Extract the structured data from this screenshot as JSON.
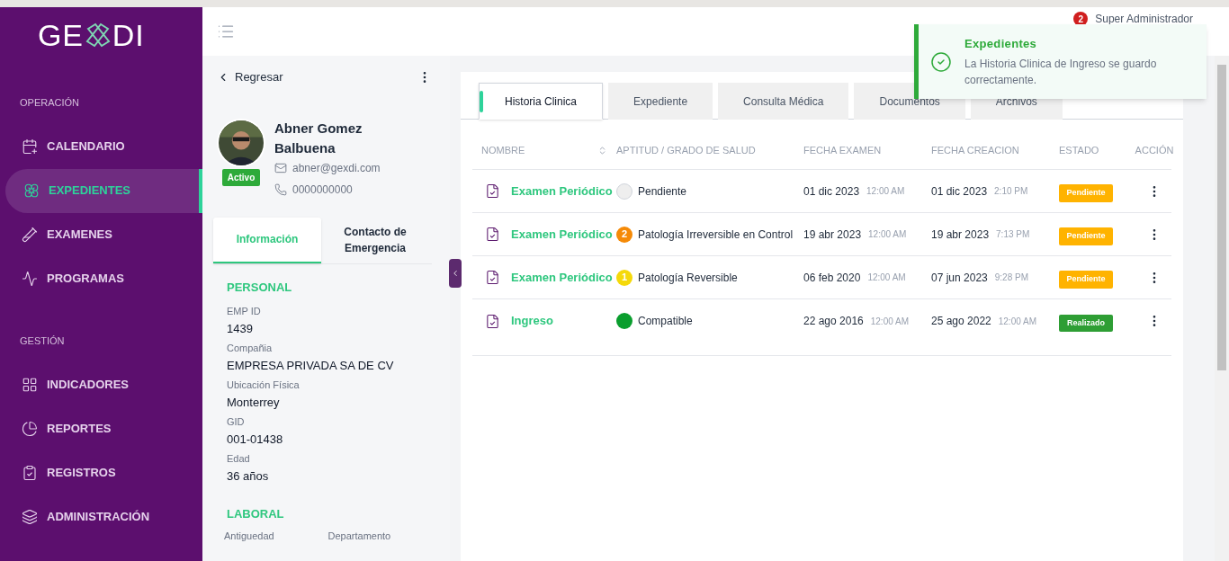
{
  "logo": {
    "left": "GE",
    "right": "DI"
  },
  "sidebar": {
    "sections": [
      {
        "title": "OPERACIÓN",
        "items": [
          {
            "label": "CALENDARIO",
            "selected": false
          },
          {
            "label": "EXPEDIENTES",
            "selected": true
          },
          {
            "label": "EXAMENES",
            "selected": false
          },
          {
            "label": "PROGRAMAS",
            "selected": false
          }
        ]
      },
      {
        "title": "GESTIÓN",
        "items": [
          {
            "label": "INDICADORES",
            "selected": false
          },
          {
            "label": "REPORTES",
            "selected": false
          },
          {
            "label": "REGISTROS",
            "selected": false
          },
          {
            "label": "ADMINISTRACIÓN",
            "selected": false
          }
        ]
      }
    ]
  },
  "header": {
    "notifications": "2",
    "user": "Super Administrador"
  },
  "toast": {
    "title": "Expedientes",
    "message": "La Historia Clinica de Ingreso se guardo correctamente."
  },
  "profile": {
    "back": "Regresar",
    "name": "Abner Gomez Balbuena",
    "status": "Activo",
    "email": "abner@gexdi.com",
    "phone": "0000000000",
    "tabs": [
      {
        "label": "Información",
        "selected": true
      },
      {
        "label": "Contacto de Emergencia",
        "selected": false
      }
    ],
    "personal_title": "PERSONAL",
    "fields": [
      {
        "label": "EMP ID",
        "value": "1439"
      },
      {
        "label": "Compañia",
        "value": "EMPRESA PRIVADA SA DE CV"
      },
      {
        "label": "Ubicación Física",
        "value": "Monterrey"
      },
      {
        "label": "GID",
        "value": "001-01438"
      },
      {
        "label": "Edad",
        "value": "36 años"
      }
    ],
    "laboral_title": "LABORAL",
    "laboral_labels": [
      "Antiguedad",
      "Departamento"
    ]
  },
  "tabs": [
    {
      "label": "Historia Clinica",
      "selected": true
    },
    {
      "label": "Expediente",
      "selected": false
    },
    {
      "label": "Consulta Médica",
      "selected": false
    },
    {
      "label": "Documentos",
      "selected": false
    },
    {
      "label": "Archivos",
      "selected": false
    }
  ],
  "table": {
    "columns": [
      "NOMBRE",
      "APTITUD / GRADO DE SALUD",
      "FECHA EXAMEN",
      "FECHA CREACION",
      "ESTADO",
      "ACCIÓN"
    ],
    "rows": [
      {
        "name": "Examen Periódico",
        "health": {
          "kind": "empty",
          "label": "Pendiente",
          "color": "#eeeeee"
        },
        "exam_date": "01 dic 2023",
        "exam_time": "12:00 AM",
        "created_date": "01 dic 2023",
        "created_time": "2:10 PM",
        "status": {
          "label": "Pendiente",
          "color": "#ffb300"
        }
      },
      {
        "name": "Examen Periódico",
        "health": {
          "kind": "number",
          "number": "2",
          "label": "Patología Irreversible en Control",
          "color": "#f58a07"
        },
        "exam_date": "19 abr 2023",
        "exam_time": "12:00 AM",
        "created_date": "19 abr 2023",
        "created_time": "7:13 PM",
        "status": {
          "label": "Pendiente",
          "color": "#ffb300"
        }
      },
      {
        "name": "Examen Periódico",
        "health": {
          "kind": "number",
          "number": "1",
          "label": "Patología Reversible",
          "color": "#f5d90a"
        },
        "exam_date": "06 feb 2020",
        "exam_time": "12:00 AM",
        "created_date": "07 jun 2023",
        "created_time": "9:28 PM",
        "status": {
          "label": "Pendiente",
          "color": "#ffb300"
        }
      },
      {
        "name": "Ingreso",
        "health": {
          "kind": "solid",
          "label": "Compatible",
          "color": "#0a9e2e"
        },
        "exam_date": "22 ago 2016",
        "exam_time": "12:00 AM",
        "created_date": "25 ago 2022",
        "created_time": "12:00 AM",
        "status": {
          "label": "Realizado",
          "color": "#2e9e34"
        }
      }
    ]
  }
}
